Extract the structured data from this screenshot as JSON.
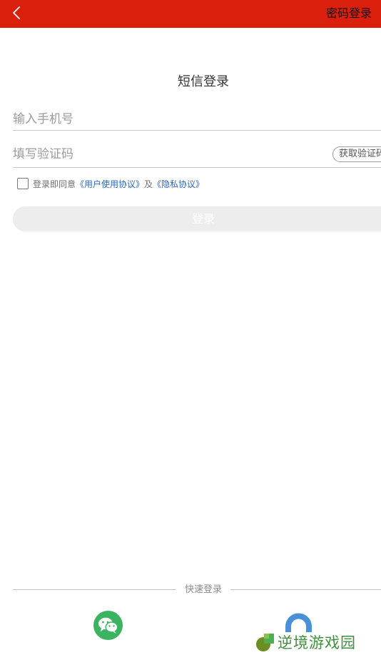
{
  "header": {
    "back_icon": "chevron-left-icon",
    "password_login": "密码登录",
    "bg_color": "#db1f0d"
  },
  "title": "短信登录",
  "phone": {
    "placeholder": "输入手机号",
    "value": ""
  },
  "code": {
    "placeholder": "填写验证码",
    "value": "",
    "get_code_label": "获取验证码"
  },
  "agreement": {
    "checked": false,
    "prefix": "登录即同意",
    "user_agreement": "《用户使用协议》",
    "conjunction": "及",
    "privacy": "《隐私协议》",
    "link_color": "#2a67b8"
  },
  "login_button": {
    "label": "登录",
    "enabled": false
  },
  "quick_login": {
    "label": "快速登录",
    "providers": [
      {
        "name": "wechat",
        "icon": "wechat-icon",
        "color": "#3bb360"
      },
      {
        "name": "qq",
        "icon": "qq-icon",
        "color": "#4a90d9"
      }
    ]
  },
  "watermark": {
    "text": "逆境游戏园",
    "logo": "leaf-logo-icon",
    "color": "#3f8f3f"
  }
}
